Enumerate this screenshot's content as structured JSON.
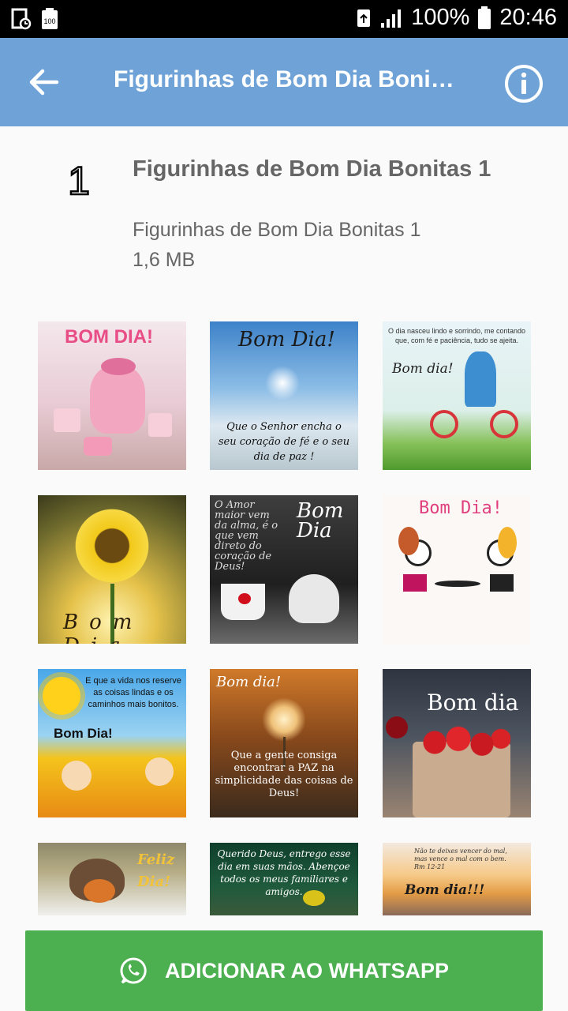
{
  "status_bar": {
    "battery_percent": "100%",
    "time": "20:46",
    "left_badge": "100"
  },
  "app_bar": {
    "title": "Figurinhas de Bom Dia Bonit…",
    "back_icon": "arrow-back-icon",
    "info_icon": "info-icon"
  },
  "pack": {
    "icon_text": "1",
    "name": "Figurinhas de Bom Dia Bonitas 1",
    "publisher": "Figurinhas de Bom Dia Bonitas 1",
    "size": "1,6 MB"
  },
  "stickers": [
    {
      "caption": "BOM DIA!",
      "text": ""
    },
    {
      "caption": "Bom Dia!",
      "text": "Que o Senhor encha o seu coração de fé e o seu dia de paz !"
    },
    {
      "caption": "Bom dia!",
      "text": "O dia nasceu lindo e sorrindo, me contando que, com fé e paciência, tudo se ajeita."
    },
    {
      "caption": "Bom Dia",
      "text": ""
    },
    {
      "caption": "Bom Dia",
      "text": "O Amor maior vem da alma, é o que vem direto do coração de Deus!"
    },
    {
      "caption": "Bom Dia!",
      "text": ""
    },
    {
      "caption": "Bom Dia!",
      "text": "E que a vida nos reserve as coisas lindas e os caminhos mais bonitos."
    },
    {
      "caption": "Bom dia!",
      "text": "Que a gente consiga encontrar a PAZ na simplicidade das coisas de Deus!"
    },
    {
      "caption": "Bom dia",
      "text": ""
    },
    {
      "caption": "Feliz Dia!",
      "text": ""
    },
    {
      "caption": "",
      "text": "Querido Deus, entrego esse dia em suas mãos. Abençoe todos os meus familiares e amigos."
    },
    {
      "caption": "Bom dia!!!",
      "text": "Não te deixes vencer do mal, mas vence o mal com o bem. Rm 12-21"
    }
  ],
  "add_button": {
    "label": "ADICIONAR AO WHATSAPP",
    "icon": "whatsapp-icon"
  },
  "colors": {
    "app_bar": "#6fa3d8",
    "button": "#4caf50"
  }
}
